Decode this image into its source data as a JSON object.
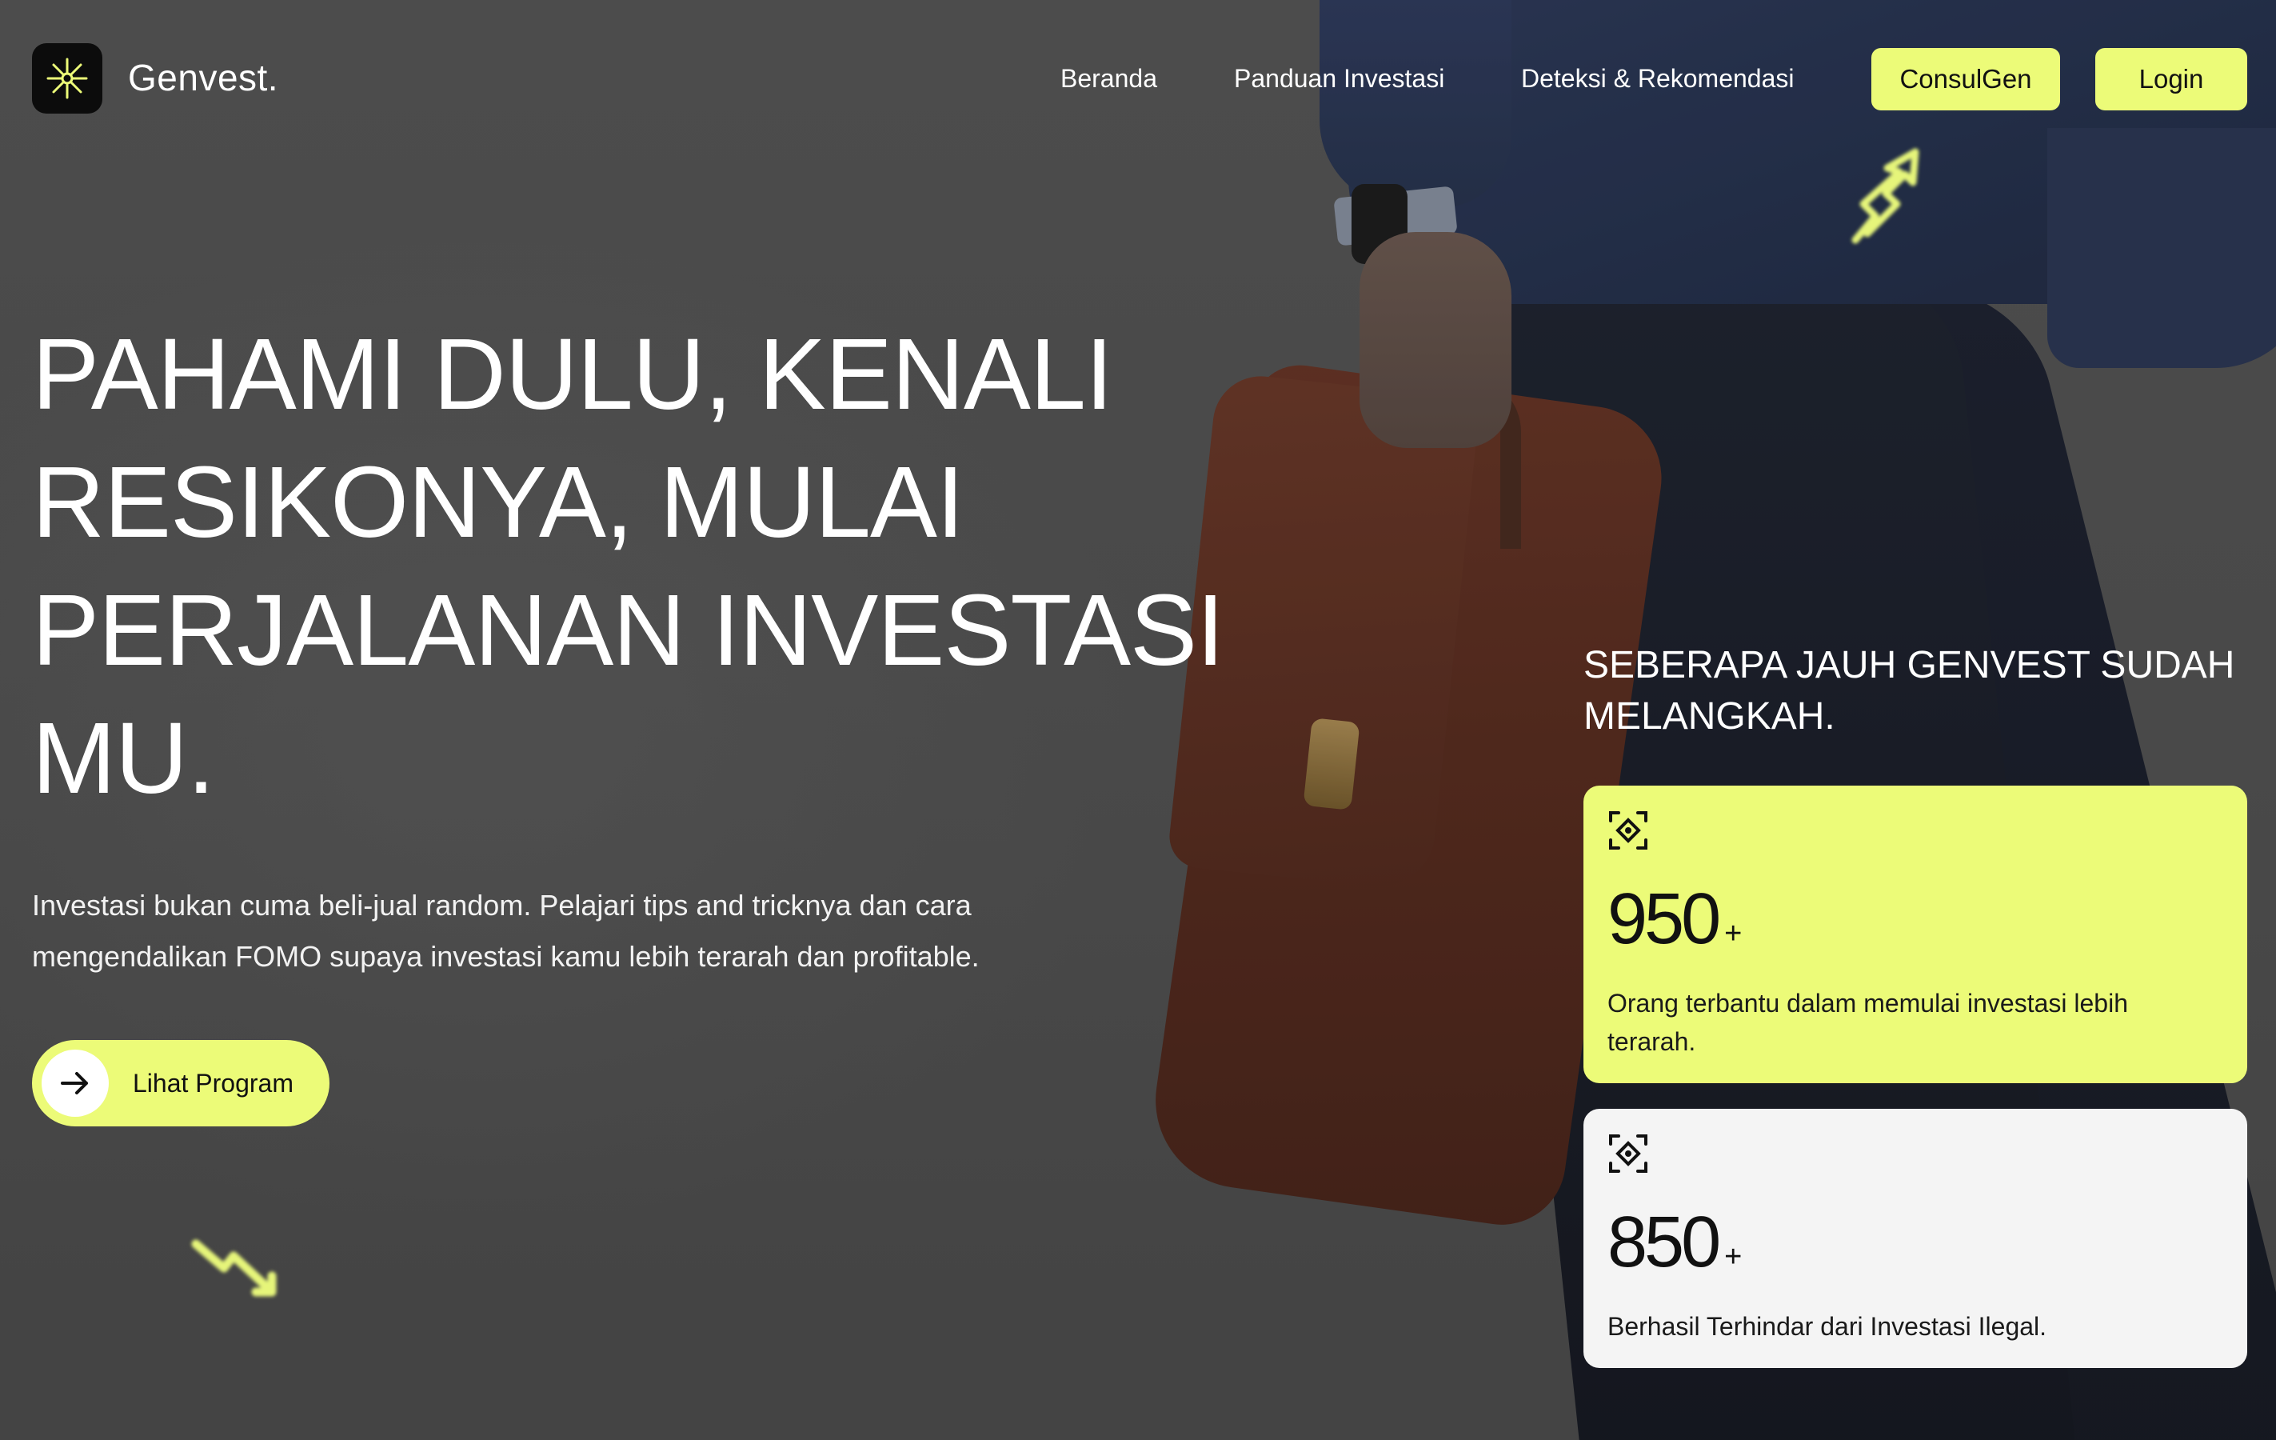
{
  "header": {
    "brand": "Genvest.",
    "nav": [
      {
        "label": "Beranda"
      },
      {
        "label": "Panduan Investasi"
      },
      {
        "label": "Deteksi & Rekomendasi"
      }
    ],
    "consul_label": "ConsulGen",
    "login_label": "Login"
  },
  "hero": {
    "title": "Pahami dulu, kenali resikonya, mulai perjalanan investasi mu.",
    "subtitle": "Investasi bukan cuma beli-jual random. Pelajari tips and tricknya dan cara mengendalikan FOMO supaya investasi kamu lebih terarah dan profitable.",
    "cta_label": "Lihat Program"
  },
  "stats": {
    "heading": "Seberapa jauh Genvest sudah melangkah.",
    "cards": [
      {
        "value": "950",
        "suffix": "+",
        "desc": "Orang terbantu dalam memulai investasi lebih terarah.",
        "icon": "focus-target-icon"
      },
      {
        "value": "850",
        "suffix": "+",
        "desc": "Berhasil Terhindar dari Investasi Ilegal.",
        "icon": "focus-target-icon"
      }
    ]
  },
  "colors": {
    "accent": "#ECFB78",
    "card_secondary": "#F4F4F4",
    "logo_bg": "#0C0C0C",
    "background": "#525252"
  },
  "icons": {
    "logo": "starburst-icon",
    "cta": "arrow-right-icon",
    "deco_up": "trend-up-arrow-icon",
    "deco_down": "trend-down-arrow-icon"
  }
}
